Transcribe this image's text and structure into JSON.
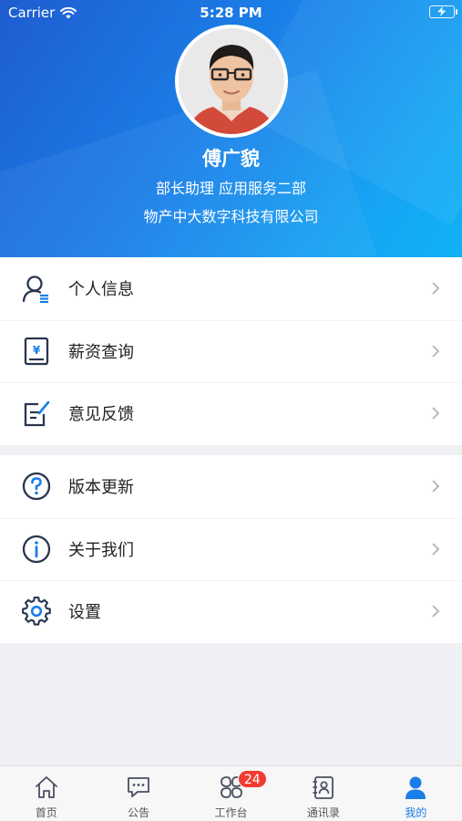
{
  "status_bar": {
    "carrier": "Carrier",
    "time": "5:28 PM"
  },
  "profile": {
    "name": "傅广貌",
    "title": "部长助理 应用服务二部",
    "company": "物产中大数字科技有限公司"
  },
  "menu_group_1": [
    {
      "label": "个人信息",
      "icon": "user-info-icon"
    },
    {
      "label": "薪资查询",
      "icon": "salary-icon"
    },
    {
      "label": "意见反馈",
      "icon": "feedback-icon"
    }
  ],
  "menu_group_2": [
    {
      "label": "版本更新",
      "icon": "question-circle-icon"
    },
    {
      "label": "关于我们",
      "icon": "info-circle-icon"
    },
    {
      "label": "设置",
      "icon": "gear-icon"
    }
  ],
  "tabbar": {
    "tabs": [
      {
        "label": "首页",
        "icon": "home-icon"
      },
      {
        "label": "公告",
        "icon": "announcement-icon"
      },
      {
        "label": "工作台",
        "icon": "workbench-icon",
        "badge": "24"
      },
      {
        "label": "通讯录",
        "icon": "contacts-icon"
      },
      {
        "label": "我的",
        "icon": "profile-icon",
        "active": true
      }
    ]
  },
  "colors": {
    "accent": "#1a7ee8",
    "icon_dark": "#2a3550",
    "badge": "#f23b32",
    "page_bg": "#eef0f4"
  }
}
